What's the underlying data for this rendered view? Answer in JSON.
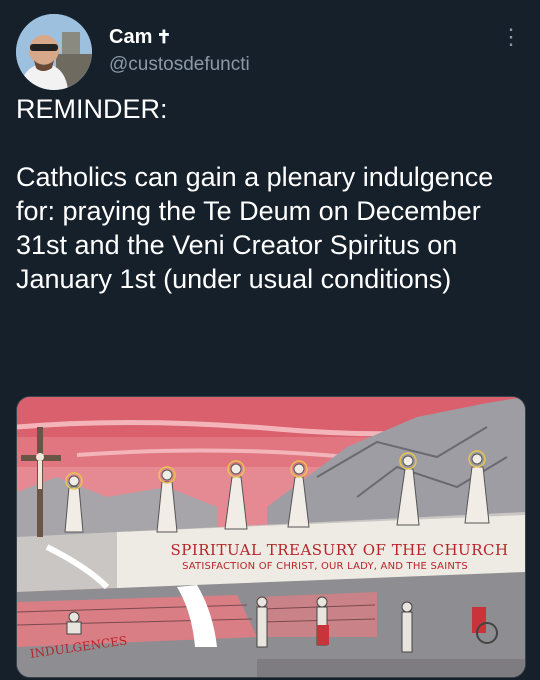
{
  "tweet": {
    "author": {
      "display_name": "Cam",
      "display_name_icon": "latin-cross-icon",
      "handle": "@custosdefuncti"
    },
    "more_icon": "vertical-ellipsis-icon",
    "text": "REMINDER:\n\nCatholics can gain a plenary indulgence for: praying the Te Deum on December 31st and the Veni Creator Spiritus on January 1st (under usual conditions)"
  },
  "media": {
    "banner_title": "SPIRITUAL TREASURY OF THE CHURCH",
    "banner_subtitle": "SATISFACTION OF CHRIST, OUR LADY, AND THE SAINTS",
    "bottom_label": "INDULGENCES"
  },
  "colors": {
    "background": "#15202b",
    "text": "#ffffff",
    "secondary_text": "#8b98a5",
    "illustration_red": "#b5252a",
    "sky_pink": "#e0707a"
  }
}
